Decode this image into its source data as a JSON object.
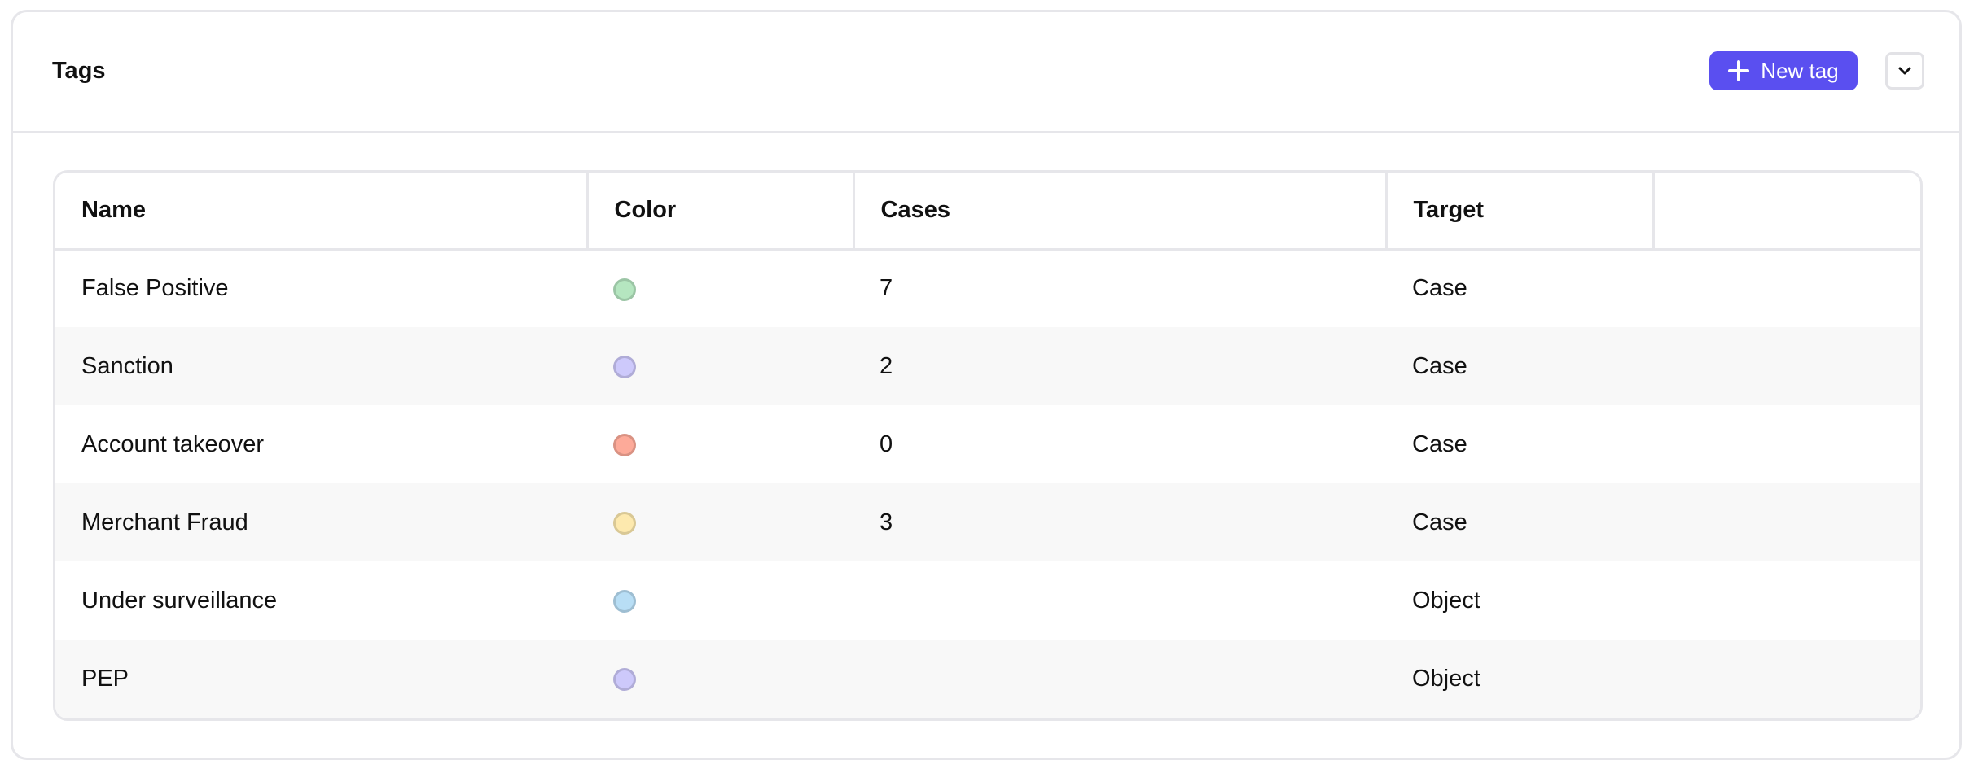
{
  "header": {
    "title": "Tags",
    "new_tag_label": "New tag"
  },
  "table": {
    "columns": [
      "Name",
      "Color",
      "Cases",
      "Target",
      ""
    ],
    "rows": [
      {
        "name": "False Positive",
        "color": "#b5e6c0",
        "cases": "7",
        "target": "Case"
      },
      {
        "name": "Sanction",
        "color": "#cdc9fb",
        "cases": "2",
        "target": "Case"
      },
      {
        "name": "Account takeover",
        "color": "#fdaa99",
        "cases": "0",
        "target": "Case"
      },
      {
        "name": "Merchant Fraud",
        "color": "#fde9ae",
        "cases": "3",
        "target": "Case"
      },
      {
        "name": "Under surveillance",
        "color": "#b8def5",
        "cases": "",
        "target": "Object"
      },
      {
        "name": "PEP",
        "color": "#cdc9fb",
        "cases": "",
        "target": "Object"
      }
    ]
  },
  "colors": {
    "accent": "#5a4ff0",
    "border": "#e6e6ea",
    "row_alt": "#f8f8f8"
  },
  "icons": {
    "add": "plus-icon",
    "collapse": "chevron-down-icon"
  }
}
